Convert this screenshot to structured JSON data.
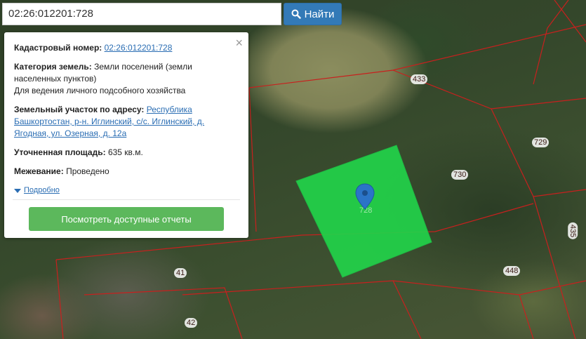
{
  "search": {
    "value": "02:26:012201:728",
    "button_label": "Найти"
  },
  "popup": {
    "cadastral_label": "Кадастровый номер:",
    "cadastral_value": "02:26:012201:728",
    "category_label": "Категория земель:",
    "category_value": "Земли поселений (земли населенных пунктов)",
    "usage": "Для ведения личного подсобного хозяйства",
    "address_label": "Земельный участок по адресу:",
    "address_value": "Республика Башкортостан, р-н. Иглинский, с/с. Иглинский, д. Ягодная, ул. Озерная, д. 12а",
    "area_label": "Уточненная площадь:",
    "area_value": "635 кв.м.",
    "survey_label": "Межевание:",
    "survey_value": "Проведено",
    "more_label": "Подробно",
    "reports_button": "Посмотреть доступные отчеты",
    "close_glyph": "×"
  },
  "map": {
    "selected_parcel_label": "728",
    "parcel_labels": [
      "433",
      "729",
      "730",
      "41",
      "42",
      "448",
      "435"
    ],
    "highlight_color": "#22d34a",
    "boundary_color": "#d02020",
    "marker_color": "#2b74c7"
  }
}
